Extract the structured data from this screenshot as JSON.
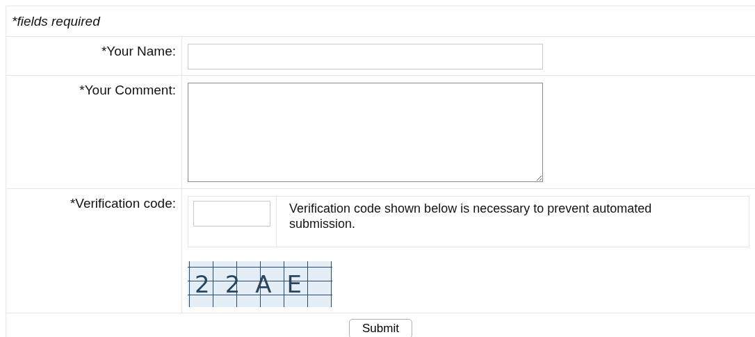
{
  "note": "*fields required",
  "fields": [
    {
      "kind": "text",
      "label": "*Your Name:"
    },
    {
      "kind": "textarea",
      "label": "*Your Comment:"
    },
    {
      "kind": "captcha",
      "label": "*Verification code:",
      "hint": "Verification code shown below is necessary to prevent automated submission.",
      "code": "22AE"
    }
  ],
  "submit": "Submit"
}
